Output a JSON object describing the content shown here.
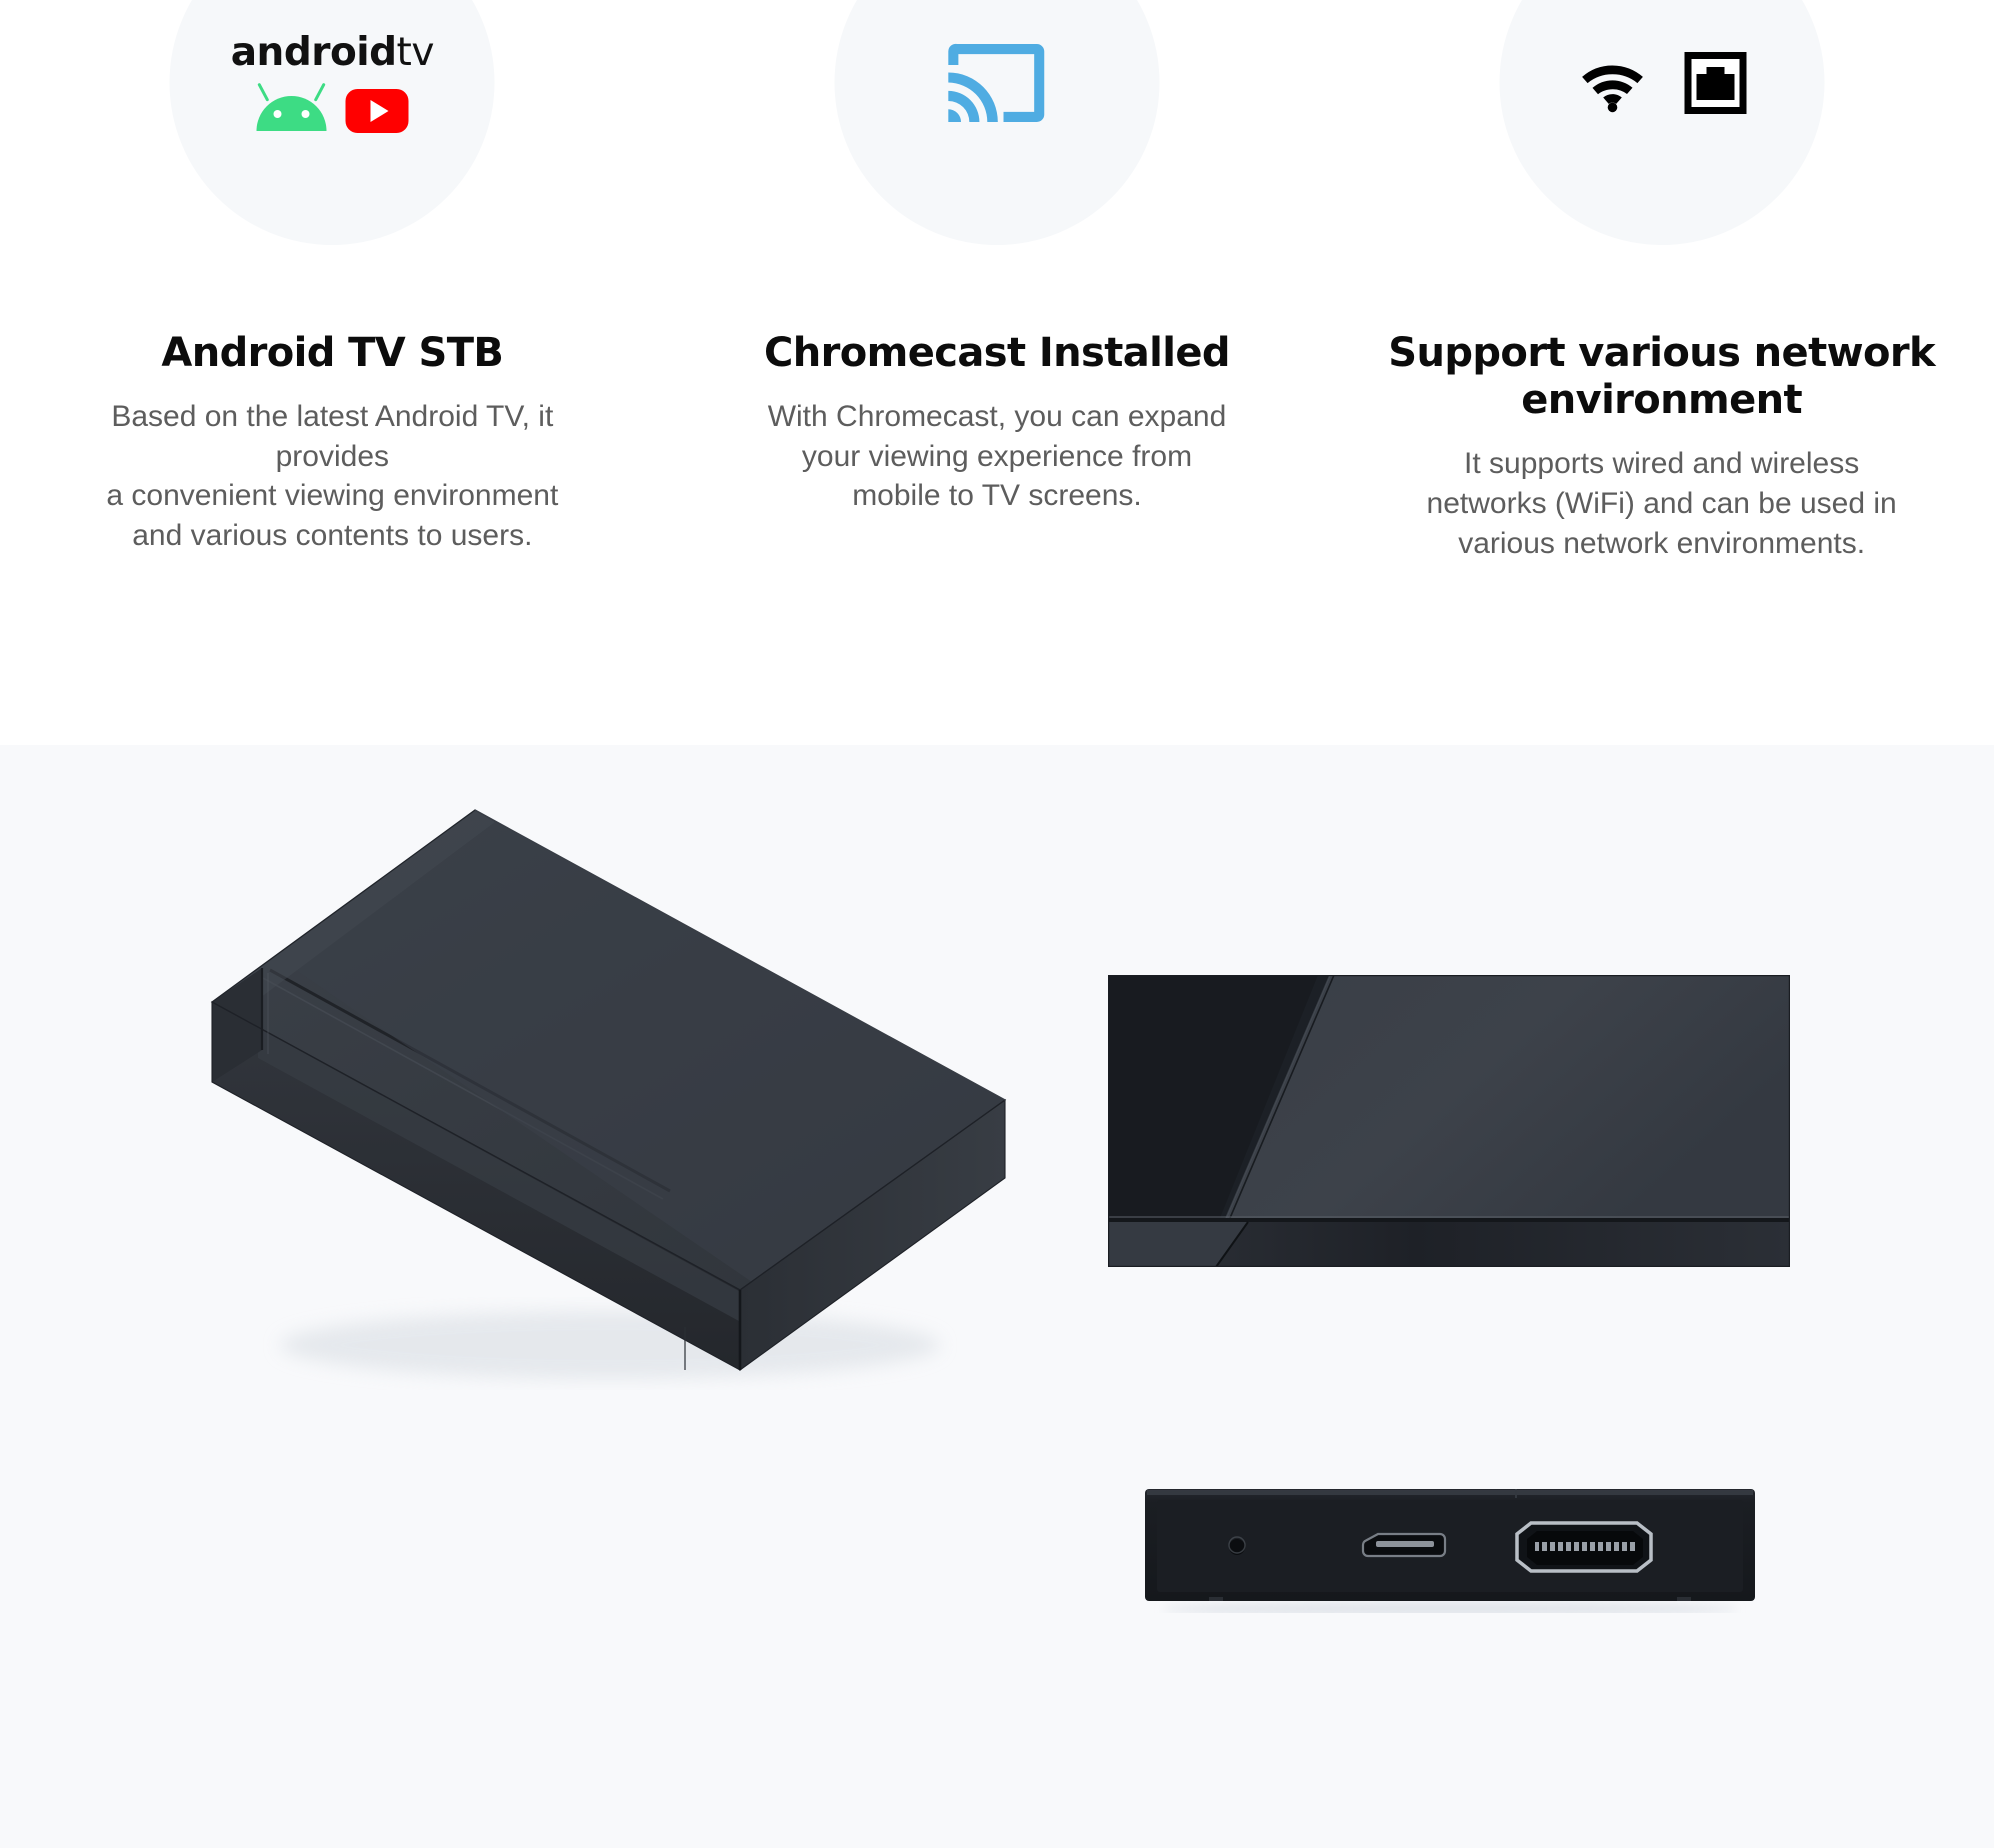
{
  "features": [
    {
      "id": "android-tv-stb",
      "icon": "android-tv-logo",
      "brand_wordmark_bold": "android",
      "brand_wordmark_light": "tv",
      "sub_icons": [
        "android-robot-icon",
        "youtube-icon"
      ],
      "title": "Android TV STB",
      "desc_lines": [
        "Based on the latest Android TV, it provides",
        "a convenient viewing environment",
        "and various contents to users."
      ]
    },
    {
      "id": "chromecast-installed",
      "icon": "chromecast-cast-icon",
      "title": "Chromecast Installed",
      "desc_lines": [
        "With Chromecast, you can expand",
        "your viewing experience from",
        "mobile to TV screens."
      ]
    },
    {
      "id": "support-various-network-environment",
      "icon": "wifi-icon",
      "icon_secondary": "ethernet-port-icon",
      "title": "Support various network environment",
      "desc_lines": [
        "It supports wired and wireless",
        "networks (WiFi) and can be used in",
        "various network environments."
      ]
    }
  ],
  "product": {
    "views": [
      {
        "id": "isometric-view",
        "label": "Android TV set-top box, isometric view"
      },
      {
        "id": "rear-view",
        "label": "Android TV set-top box, top view"
      },
      {
        "id": "port-view",
        "label": "Android TV set-top box, port side view"
      }
    ],
    "ports": [
      "reset-pinhole",
      "micro-usb-port",
      "hdmi-port"
    ]
  },
  "colors": {
    "circle_background": "#F6F8FA",
    "panel_background": "#F8F9FB",
    "page_background": "#FFFFFF",
    "cast_blue": "#4FACE2",
    "android_green": "#3DDC84",
    "youtube_red": "#FF0000",
    "title_text": "#0C0C0C",
    "body_text": "#5D5D5D",
    "device_dark": "#2E3238",
    "device_mid": "#3A3F46",
    "device_light": "#474C54"
  }
}
